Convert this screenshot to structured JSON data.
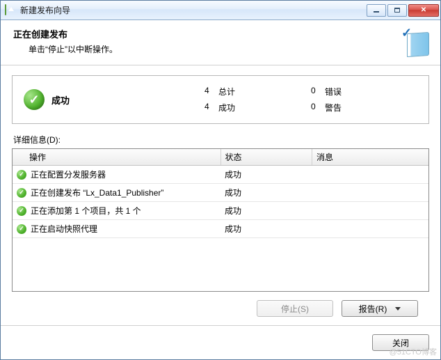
{
  "window": {
    "title": "新建发布向导"
  },
  "header": {
    "title": "正在创建发布",
    "subtitle": "单击“停止”以中断操作。"
  },
  "summary": {
    "status_label": "成功",
    "stats": {
      "total_n": "4",
      "total_label": "总计",
      "success_n": "4",
      "success_label": "成功",
      "error_n": "0",
      "error_label": "错误",
      "warning_n": "0",
      "warning_label": "警告"
    }
  },
  "details": {
    "label": "详细信息(D):",
    "columns": {
      "operation": "操作",
      "status": "状态",
      "message": "消息"
    },
    "rows": [
      {
        "op": "正在配置分发服务器",
        "status": "成功",
        "msg": ""
      },
      {
        "op": "正在创建发布 “Lx_Data1_Publisher”",
        "status": "成功",
        "msg": ""
      },
      {
        "op": "正在添加第 1 个项目，共 1 个",
        "status": "成功",
        "msg": ""
      },
      {
        "op": "正在启动快照代理",
        "status": "成功",
        "msg": ""
      }
    ]
  },
  "buttons": {
    "stop": "停止(S)",
    "report": "报告(R)",
    "close": "关闭"
  },
  "watermark": "@51CTO博客"
}
